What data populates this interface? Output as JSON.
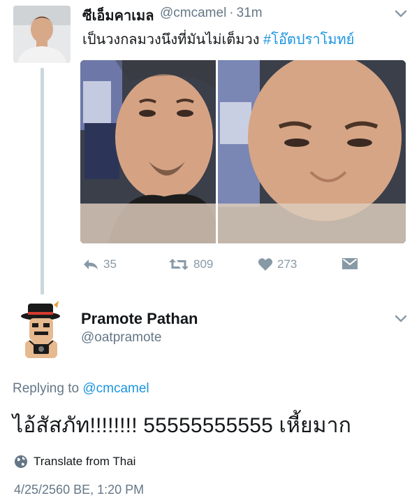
{
  "tweet1": {
    "display_name": "ซีเอ็มคาเมล",
    "handle": "@cmcamel",
    "separator": "·",
    "time": "31m",
    "text": "เป็นวงกลมวงนึงที่มันไม่เต็มวง ",
    "hashtag": "#โอ๊ตปราโมทย์",
    "actions": {
      "reply_count": "35",
      "retweet_count": "809",
      "like_count": "273"
    }
  },
  "tweet2": {
    "display_name": "Pramote Pathan",
    "handle": "@oatpramote",
    "replying_prefix": "Replying to ",
    "replying_to": "@cmcamel",
    "text": "ไอ้สัสภัท!!!!!!!! 55555555555 เหี้ยมาก",
    "translate_label": "Translate from Thai",
    "timestamp": "4/25/2560 BE, 1:20 PM"
  },
  "icons": {
    "reply": "reply-icon",
    "retweet": "retweet-icon",
    "like": "heart-icon",
    "dm": "envelope-icon",
    "globe": "globe-icon",
    "caret": "chevron-down-icon"
  },
  "colors": {
    "link": "#1b95e0",
    "muted": "#657786",
    "action_gray": "#8899a6",
    "text": "#14171a"
  }
}
